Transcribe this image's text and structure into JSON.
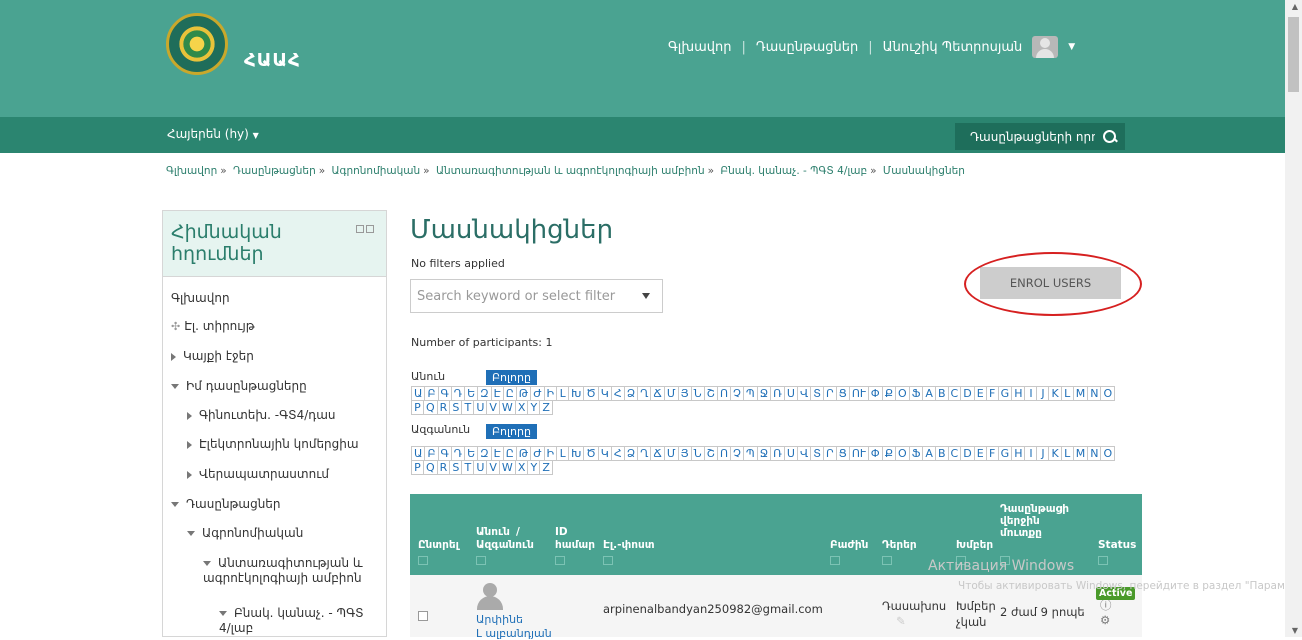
{
  "header": {
    "logo_text": "ՀԱԱՀ",
    "nav": [
      "Գլխավոր",
      "Դասընթացներ",
      "Անուշիկ Պետրոսյան"
    ],
    "lang": "Հայերեն (hy)",
    "search_label": "Դասընթացների որո"
  },
  "breadcrumb": [
    "Գլխավոր",
    "Դասընթացներ",
    "Ագրոնոմիական",
    "Անտառագիտության և ագրոէկոլոգիայի ամբիոն",
    "Բնակ. կանաչ. - ՊԳՏ 4/լաբ",
    "Մասնակիցներ"
  ],
  "sidebar": {
    "title": "Հիմնական հղումներ",
    "items": [
      "Գլխավոր",
      "Էլ. տիրույթ",
      "Կայքի էջեր",
      "Իմ դասընթացները",
      "Գինուտեխ. -ԳՏ4/դաս",
      "Էլեկտրոնային կոմերցիա",
      "Վերապատրաստում",
      "Դասընթացներ",
      "Ագրոնոմիական",
      "Անտառագիտության և ագրոէկոլոգիայի ամբիոն",
      "Բնակ. կանաչ. - ՊԳՏ 4/լաբ"
    ]
  },
  "main": {
    "title": "Մասնակիցներ",
    "no_filters": "No filters applied",
    "filter_placeholder": "Search keyword or select filter",
    "enrol_label": "ENROL USERS",
    "participants": "Number of participants: 1",
    "firstname_label": "Անուն",
    "lastname_label": "Ազգանուն",
    "all_label": "Բոլորը",
    "letters": [
      "Ա",
      "Բ",
      "Գ",
      "Դ",
      "Ե",
      "Զ",
      "Է",
      "Ը",
      "Թ",
      "Ժ",
      "Ի",
      "Լ",
      "Խ",
      "Ծ",
      "Կ",
      "Հ",
      "Ձ",
      "Ղ",
      "Ճ",
      "Մ",
      "Յ",
      "Ն",
      "Շ",
      "Ո",
      "Չ",
      "Պ",
      "Ջ",
      "Ռ",
      "Ս",
      "Վ",
      "Տ",
      "Ր",
      "Ց",
      "ՈՒ",
      "Փ",
      "Ք",
      "Օ",
      "Ֆ",
      "A",
      "B",
      "C",
      "D",
      "E",
      "F",
      "G",
      "H",
      "I",
      "J",
      "K",
      "L",
      "M",
      "N",
      "O",
      "P",
      "Q",
      "R",
      "S",
      "T",
      "U",
      "V",
      "W",
      "X",
      "Y",
      "Z"
    ]
  },
  "table": {
    "headers": {
      "select": "Ընտրել",
      "name": "Անուն",
      "name_sep": "/",
      "surname": "Ազգանուն",
      "id": "ID",
      "id2": "համար",
      "email": "Էլ.-փոստ",
      "dept": "Բաժին",
      "roles": "Դերեր",
      "groups": "Խմբեր",
      "lastaccess1": "Դասընթացի",
      "lastaccess2": "վերջին",
      "lastaccess3": "մուտքը",
      "status": "Status"
    },
    "row": {
      "name1": "Արփինե",
      "name2": "Լ ալբանդյան",
      "email": "arpinenalbandyan250982@gmail.com",
      "role": "Դասախոս",
      "group1": "Խմբեր",
      "group2": "չկան",
      "lastaccess": "2 ժամ 9 րոպե",
      "status": "Active"
    }
  },
  "watermark": {
    "title": "Активация Windows",
    "text": "Чтобы активировать Windows, перейдите в раздел \"Параметры\"."
  }
}
